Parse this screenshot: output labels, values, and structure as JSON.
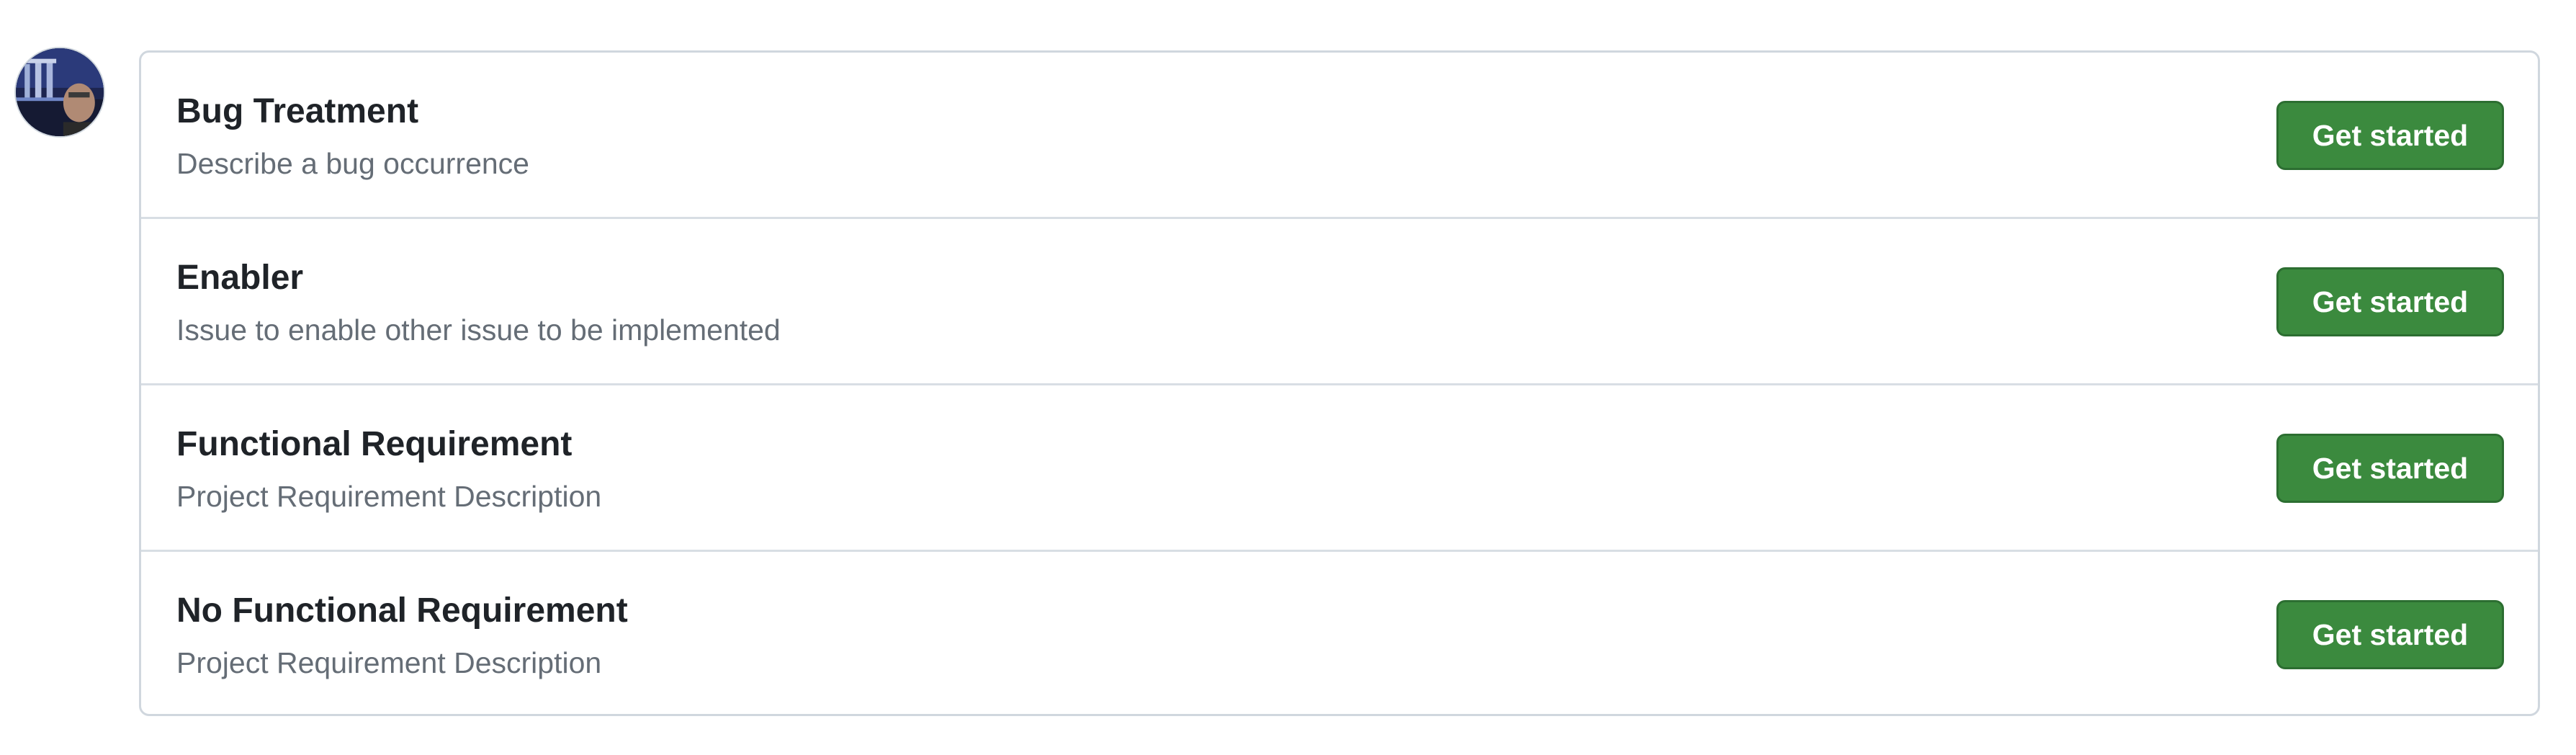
{
  "templates": [
    {
      "title": "Bug Treatment",
      "description": "Describe a bug occurrence",
      "button": "Get started"
    },
    {
      "title": "Enabler",
      "description": "Issue to enable other issue to be implemented",
      "button": "Get started"
    },
    {
      "title": "Functional Requirement",
      "description": "Project Requirement Description",
      "button": "Get started"
    },
    {
      "title": "No Functional Requirement",
      "description": "Project Requirement Description",
      "button": "Get started"
    }
  ],
  "colors": {
    "button_bg": "#3b8a3e",
    "button_border": "#2c6e31",
    "border": "#d0d7de",
    "title_text": "#1f2328",
    "description_text": "#656d76"
  }
}
